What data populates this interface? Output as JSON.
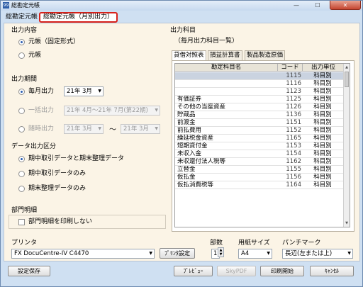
{
  "window": {
    "title": "総勘定元帳",
    "close_glyph": "✕",
    "minimize_glyph": "—",
    "maximize_glyph": "☐"
  },
  "tabs": [
    {
      "label": "総勘定元帳"
    },
    {
      "label": "総勘定元帳（月別出力）"
    }
  ],
  "output_content": {
    "title": "出力内容",
    "options": [
      {
        "label": "元帳（固定形式）",
        "selected": true
      },
      {
        "label": "元帳",
        "selected": false
      }
    ]
  },
  "output_period": {
    "title": "出力期間",
    "monthly": {
      "label": "毎月出力",
      "selected": true,
      "value": "21年 3月"
    },
    "range": {
      "label": "一括出力",
      "selected": false,
      "value": "21年 4月〜21年 7月(第22期)"
    },
    "anytime": {
      "label": "随時出力",
      "selected": false,
      "from": "21年 3月",
      "to": "21年 3月",
      "separator": "〜"
    }
  },
  "data_section": {
    "title": "データ出力区分",
    "options": [
      {
        "label": "期中取引データと期末整理データ",
        "selected": true
      },
      {
        "label": "期中取引データのみ",
        "selected": false
      },
      {
        "label": "期末整理データのみ",
        "selected": false
      }
    ]
  },
  "department": {
    "title": "部門明細",
    "checkbox_label": "部門明細を印刷しない",
    "checked": false
  },
  "accounts": {
    "title": "出力科目",
    "subtitle": "（毎月出力科目一覧）",
    "tabs": [
      {
        "label": "貸借対照表",
        "active": true
      },
      {
        "label": "損益計算書",
        "active": false
      },
      {
        "label": "製品製造原価",
        "active": false
      }
    ],
    "columns": [
      "勘定科目名",
      "コード",
      "出力単位"
    ],
    "rows": [
      {
        "name": "",
        "code": "1115",
        "unit": "科目別"
      },
      {
        "name": "",
        "code": "1116",
        "unit": "科目別"
      },
      {
        "name": "",
        "code": "1123",
        "unit": "科目別"
      },
      {
        "name": "有価証券",
        "code": "1125",
        "unit": "科目別"
      },
      {
        "name": "その他の当座資産",
        "code": "1126",
        "unit": "科目別"
      },
      {
        "name": "貯蔵品",
        "code": "1136",
        "unit": "科目別"
      },
      {
        "name": "前渡金",
        "code": "1151",
        "unit": "科目別"
      },
      {
        "name": "前払費用",
        "code": "1152",
        "unit": "科目別"
      },
      {
        "name": "繰延税金資産",
        "code": "1165",
        "unit": "科目別"
      },
      {
        "name": "短期貸付金",
        "code": "1153",
        "unit": "科目別"
      },
      {
        "name": "未収入金",
        "code": "1154",
        "unit": "科目別"
      },
      {
        "name": "未収還付法人税等",
        "code": "1162",
        "unit": "科目別"
      },
      {
        "name": "立替金",
        "code": "1155",
        "unit": "科目別"
      },
      {
        "name": "仮払金",
        "code": "1156",
        "unit": "科目別"
      },
      {
        "name": "仮払消費税等",
        "code": "1164",
        "unit": "科目別"
      }
    ]
  },
  "printer": {
    "title": "プリンタ",
    "value": "FX DocuCentre-IV C4470",
    "settings_button": "ﾌﾟﾘﾝﾀ設定"
  },
  "copies": {
    "title": "部数",
    "value": "1"
  },
  "paper": {
    "title": "用紙サイズ",
    "value": "A4"
  },
  "punch": {
    "title": "パンチマーク",
    "value": "長辺(左または上)"
  },
  "buttons": {
    "save": "設定保存",
    "preview": "ﾌﾟﾚﾋﾞｭｰ",
    "skypdf": "SkyPDF",
    "print": "印刷開始",
    "cancel": "ｷｬﾝｾﾙ"
  }
}
